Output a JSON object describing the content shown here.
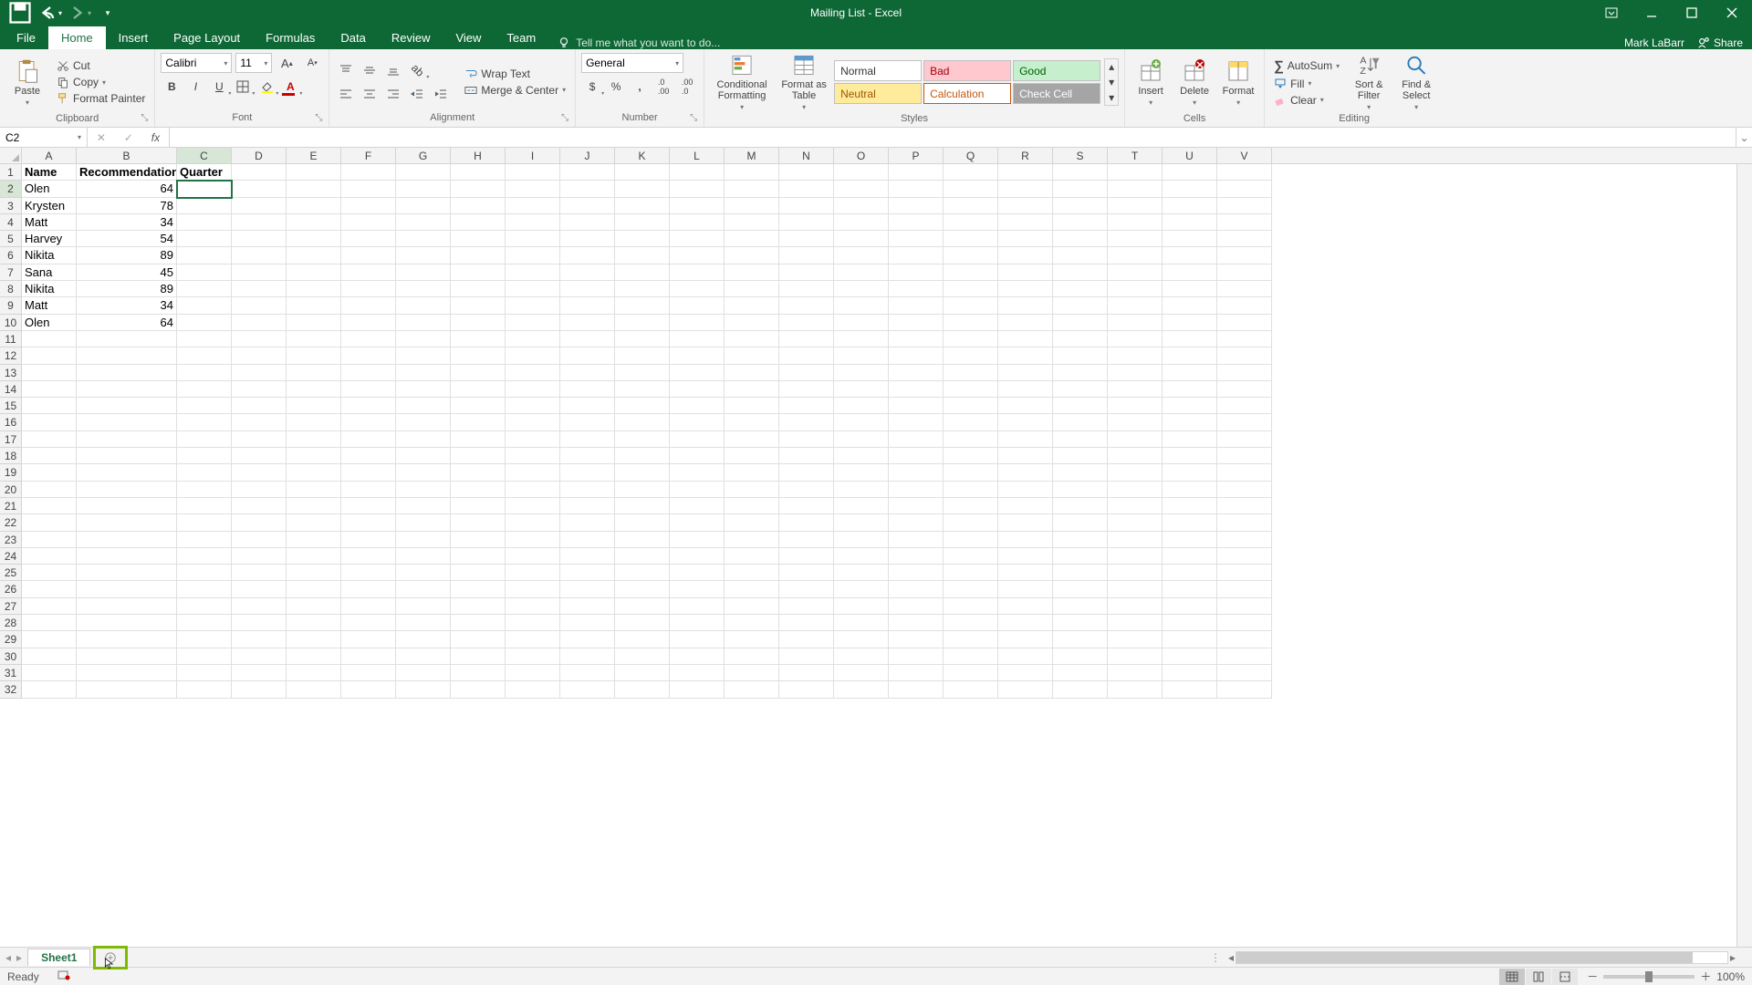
{
  "title": "Mailing List - Excel",
  "user": "Mark LaBarr",
  "share_label": "Share",
  "tabs": {
    "file": "File",
    "home": "Home",
    "insert": "Insert",
    "pagelayout": "Page Layout",
    "formulas": "Formulas",
    "data": "Data",
    "review": "Review",
    "view": "View",
    "team": "Team"
  },
  "tellme_placeholder": "Tell me what you want to do...",
  "ribbon": {
    "clipboard": {
      "label": "Clipboard",
      "paste": "Paste",
      "cut": "Cut",
      "copy": "Copy",
      "painter": "Format Painter"
    },
    "font": {
      "label": "Font",
      "name": "Calibri",
      "size": "11"
    },
    "alignment": {
      "label": "Alignment",
      "wrap": "Wrap Text",
      "merge": "Merge & Center"
    },
    "number": {
      "label": "Number",
      "format": "General"
    },
    "styles": {
      "label": "Styles",
      "cond": "Conditional Formatting",
      "table": "Format as Table",
      "normal": "Normal",
      "bad": "Bad",
      "good": "Good",
      "neutral": "Neutral",
      "calc": "Calculation",
      "check": "Check Cell"
    },
    "cells": {
      "label": "Cells",
      "insert": "Insert",
      "delete": "Delete",
      "format": "Format"
    },
    "editing": {
      "label": "Editing",
      "autosum": "AutoSum",
      "fill": "Fill",
      "clear": "Clear",
      "sort": "Sort & Filter",
      "find": "Find & Select"
    }
  },
  "namebox": "C2",
  "chart_data": {
    "type": "table",
    "columns": [
      "A",
      "B",
      "C",
      "D",
      "E",
      "F",
      "G",
      "H",
      "I",
      "J",
      "K",
      "L",
      "M",
      "N",
      "O",
      "P",
      "Q",
      "R",
      "S",
      "T",
      "U",
      "V"
    ],
    "headers": {
      "A": "Name",
      "B": "Recommendations",
      "C": "Quarter"
    },
    "rows": [
      {
        "A": "Olen",
        "B": 64
      },
      {
        "A": "Krysten",
        "B": 78
      },
      {
        "A": "Matt",
        "B": 34
      },
      {
        "A": "Harvey",
        "B": 54
      },
      {
        "A": "Nikita",
        "B": 89
      },
      {
        "A": "Sana",
        "B": 45
      },
      {
        "A": "Nikita",
        "B": 89
      },
      {
        "A": "Matt",
        "B": 34
      },
      {
        "A": "Olen",
        "B": 64
      }
    ],
    "selected_cell": "C2",
    "visible_row_count": 32
  },
  "sheet": {
    "name": "Sheet1"
  },
  "status": {
    "ready": "Ready",
    "zoom": "100%"
  }
}
